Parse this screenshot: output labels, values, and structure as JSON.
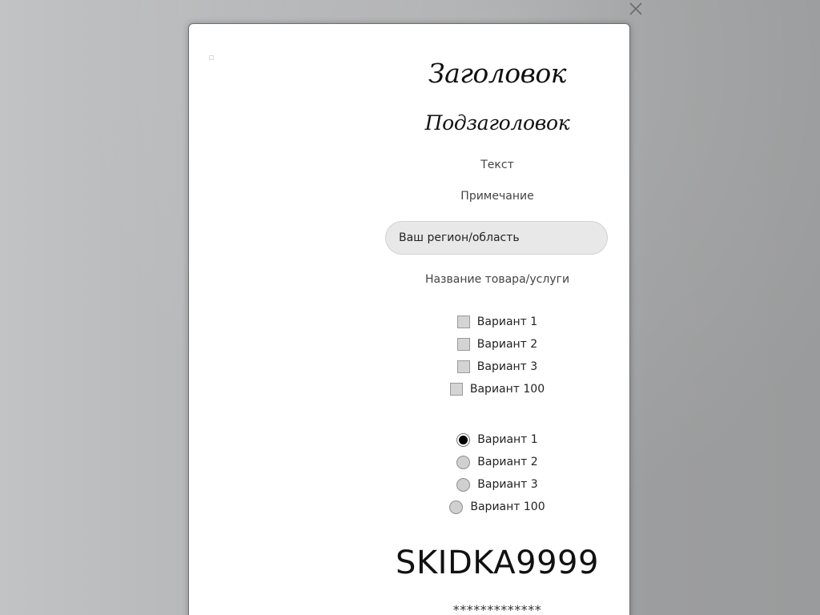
{
  "modal": {
    "title": "Заголовок",
    "subtitle": "Подзаголовок",
    "text": "Текст",
    "note": "Примечание",
    "region_field": {
      "value": "Ваш регион/область"
    },
    "product_label": "Название товара/услуги",
    "checkboxes": [
      {
        "label": "Вариант 1",
        "checked": false
      },
      {
        "label": "Вариант 2",
        "checked": false
      },
      {
        "label": "Вариант 3",
        "checked": false
      },
      {
        "label": "Вариант 100",
        "checked": false
      }
    ],
    "radios": [
      {
        "label": "Вариант 1",
        "checked": true
      },
      {
        "label": "Вариант 2",
        "checked": false
      },
      {
        "label": "Вариант 3",
        "checked": false
      },
      {
        "label": "Вариант 100",
        "checked": false
      }
    ],
    "promo_code": "SKIDKA9999",
    "masked_text": "*************"
  },
  "icons": {
    "close": "close-icon"
  }
}
